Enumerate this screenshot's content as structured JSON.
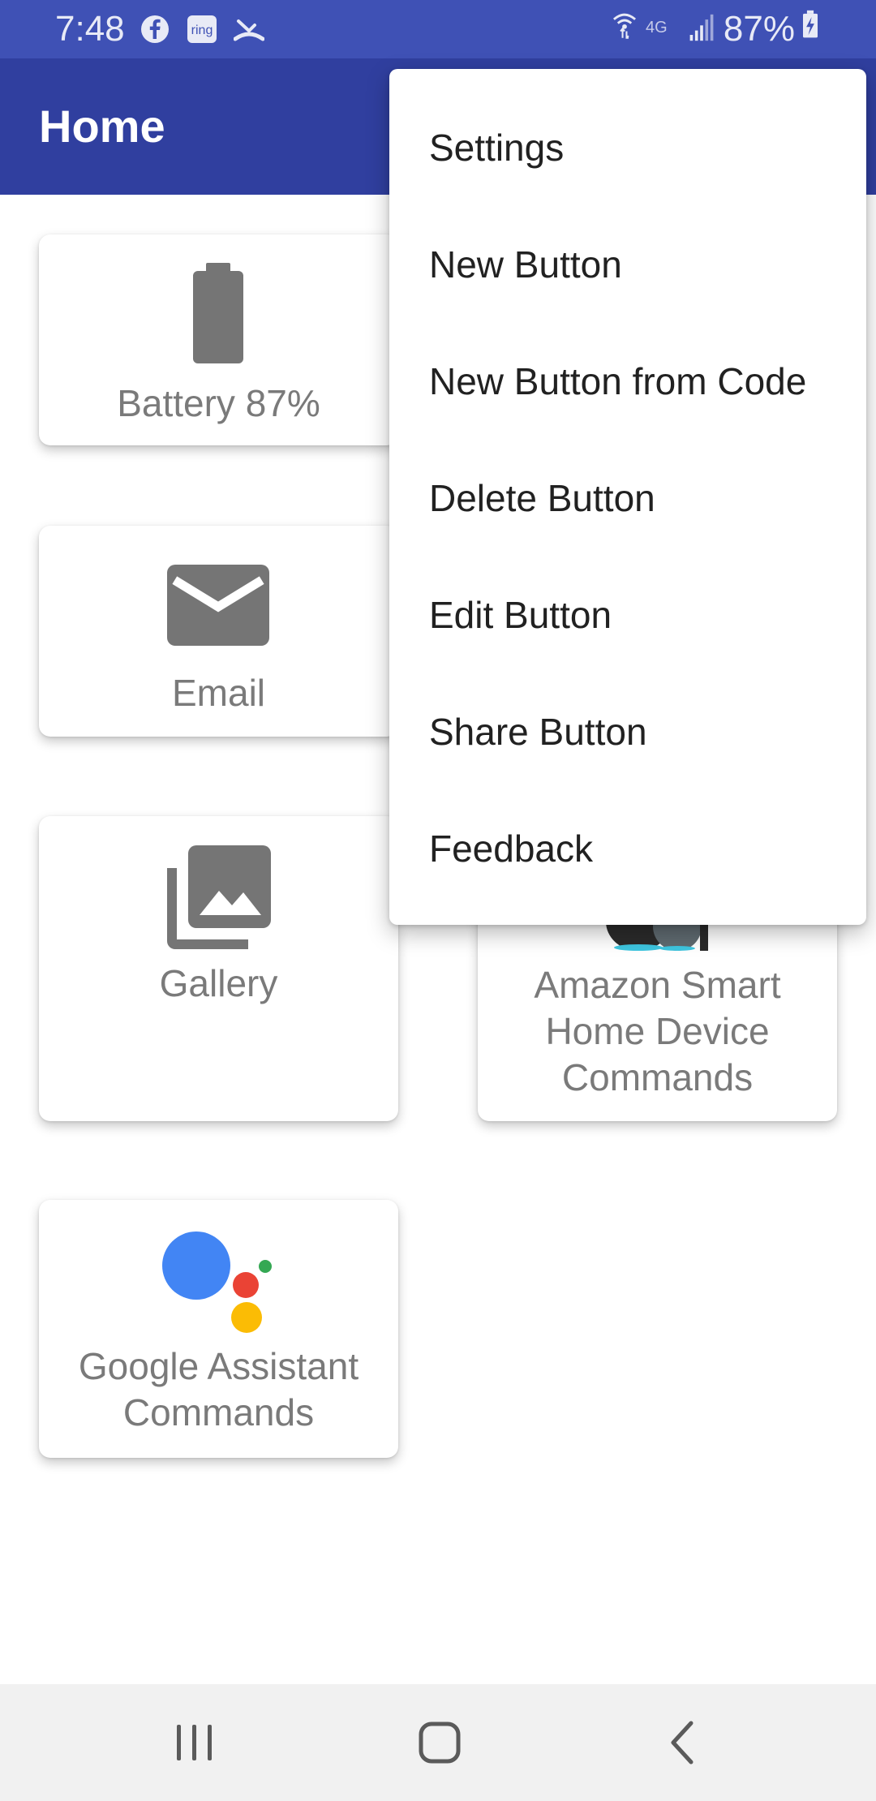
{
  "status_bar": {
    "time": "7:48",
    "battery_text": "87%",
    "icons": [
      "facebook-icon",
      "ring-icon",
      "missed-call-icon",
      "wifi-icon",
      "4g-icon",
      "signal-icon",
      "battery-charging-icon"
    ],
    "ring_text": "ring",
    "network_text": "4G"
  },
  "app_bar": {
    "title": "Home"
  },
  "tiles": [
    {
      "label": "Battery 87%",
      "icon": "battery-icon"
    },
    {
      "label": "Email",
      "icon": "email-icon"
    },
    {
      "label": "Gallery",
      "icon": "gallery-icon"
    },
    {
      "label_lines": [
        "Amazon Smart",
        "Home Device",
        "Commands"
      ],
      "icon": "smart-speaker-image"
    },
    {
      "label_lines": [
        "Google Assistant",
        "Commands"
      ],
      "icon": "google-assistant-icon"
    }
  ],
  "menu": {
    "items": [
      {
        "label": "Settings"
      },
      {
        "label": "New Button"
      },
      {
        "label": "New Button from Code"
      },
      {
        "label": "Delete Button"
      },
      {
        "label": "Edit Button"
      },
      {
        "label": "Share Button"
      },
      {
        "label": "Feedback"
      }
    ]
  },
  "nav_bar": {
    "buttons": [
      "recent-apps-icon",
      "home-icon",
      "back-icon"
    ]
  },
  "colors": {
    "status_bar": "#3f51b5",
    "app_bar": "#303f9f",
    "icon_gray": "#757575",
    "label_gray": "#7a7a7a",
    "assistant_blue": "#4285f4",
    "assistant_red": "#ea4335",
    "assistant_yellow": "#fbbc05",
    "assistant_green": "#34a853"
  }
}
